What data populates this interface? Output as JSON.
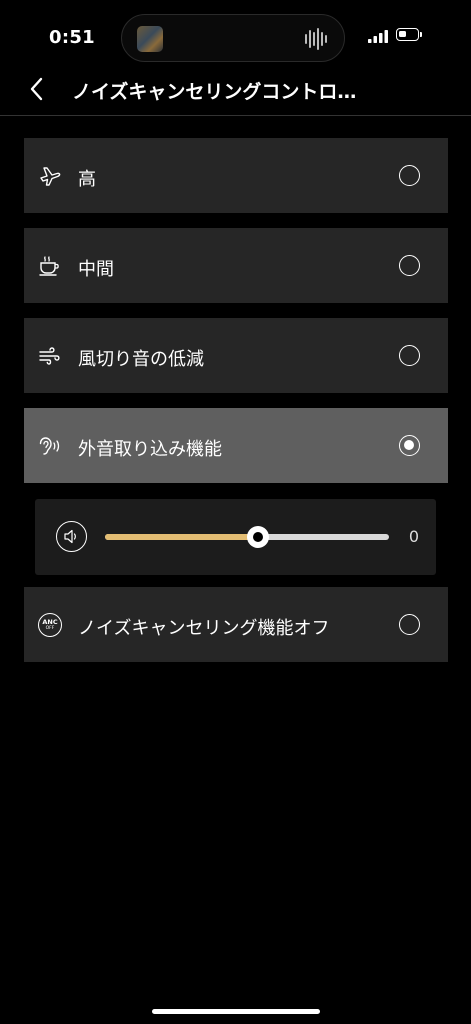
{
  "status_bar": {
    "time": "0:51",
    "battery_level": 0.3
  },
  "nav": {
    "title": "ノイズキャンセリングコントロ…",
    "back_icon": "chevron-left-icon"
  },
  "options": [
    {
      "label": "高",
      "icon": "airplane-icon",
      "selected": false
    },
    {
      "label": "中間",
      "icon": "coffee-cup-icon",
      "selected": false
    },
    {
      "label": "風切り音の低減",
      "icon": "wind-icon",
      "selected": false
    },
    {
      "label": "外音取り込み機能",
      "icon": "ear-icon",
      "selected": true
    },
    {
      "label": "ノイズキャンセリング機能オフ",
      "icon": "anc-off-icon",
      "selected": false
    }
  ],
  "ambient_slider": {
    "icon": "speaker-icon",
    "value": "0",
    "level": 0.54
  },
  "anc_badge": {
    "top": "ANC",
    "bottom": "OFF"
  },
  "colors": {
    "background": "#000000",
    "row": "#262626",
    "row_selected": "#5f5f5f",
    "slider_accent": "#e3bd73"
  }
}
